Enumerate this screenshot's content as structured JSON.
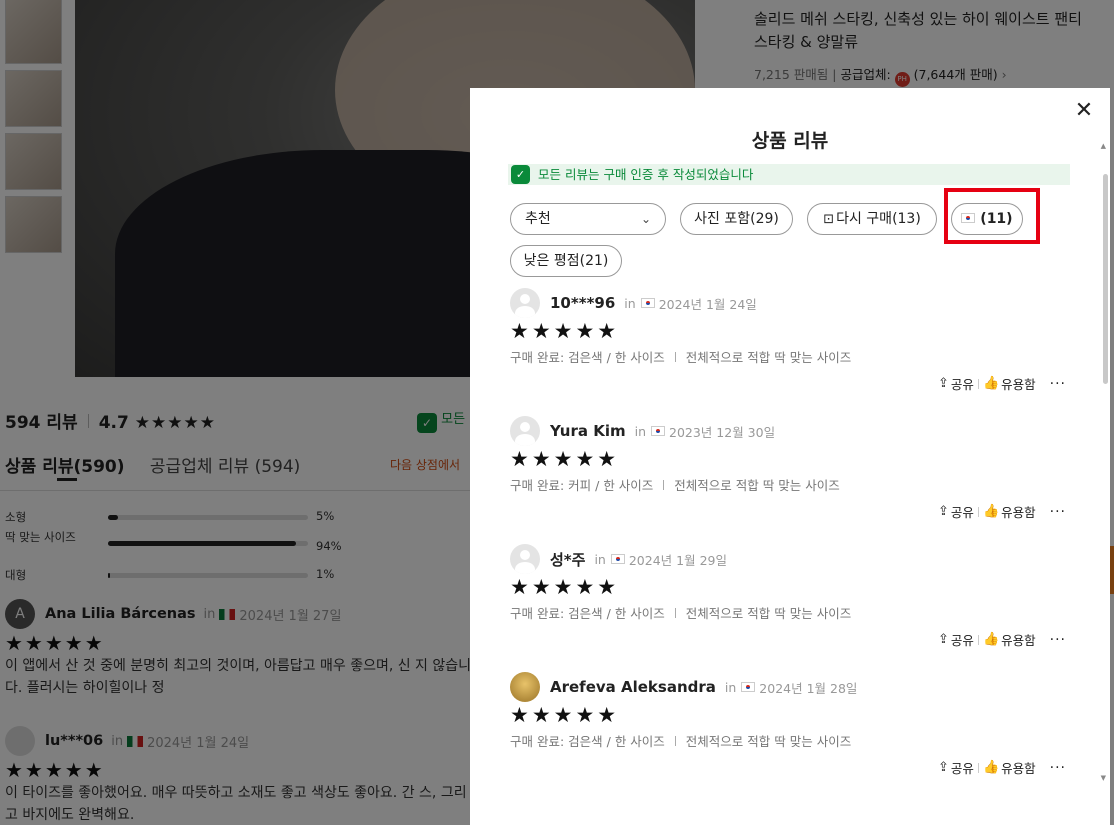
{
  "background": {
    "product_title": "솔리드 메쉬 스타킹, 신축성 있는 하이 웨이스트 팬티 스타킹 & 양말류",
    "sold": "7,215 판매됨",
    "supplier_label": "공급업체:",
    "supplier_sales": "(7,644개 판매)",
    "review_count": "594 리뷰",
    "rating": "4.7",
    "rating_stars": "★★★★★",
    "verified_short": "모든",
    "tab_product": "상품 리뷰(590)",
    "tab_supplier": "공급업체 리뷰 (594)",
    "next_store": "다음 상점에서",
    "fit": [
      {
        "label": "소형",
        "pct": "5%",
        "value": 0.05
      },
      {
        "label": "딱 맞는 사이즈",
        "pct": "94%",
        "value": 0.94
      },
      {
        "label": "대형",
        "pct": "1%",
        "value": 0.01
      }
    ],
    "reviews": [
      {
        "avatar": "A",
        "name": "Ana Lilia Bárcenas",
        "in": "in",
        "date": "2024년 1월 27일",
        "stars": "★★★★★",
        "text": "이 앱에서 산 것 중에 분명히 최고의 것이며, 아름답고 매우 좋으며, 신 지 않습니다. 플러시는 하이힐이나 정"
      },
      {
        "avatar": "",
        "name": "lu***06",
        "in": "in",
        "date": "2024년 1월 24일",
        "stars": "★★★★★",
        "text": "이 타이즈를 좋아했어요. 매우 따뜻하고 소재도 좋고 색상도 좋아요. 간 스, 그리고 바지에도 완벽해요."
      }
    ]
  },
  "modal": {
    "title": "상품 리뷰",
    "notice": "모든 리뷰는 구매 인증 후 작성되었습니다",
    "filters": {
      "sort": "추천",
      "photo": "사진 포함(29)",
      "repurchase": "다시 구매(13)",
      "country": "(11)",
      "low_rating": "낮은 평점(21)"
    },
    "reviews": [
      {
        "name": "10***96",
        "in": "in",
        "date": "2024년 1월 24일",
        "stars": "★★★★★",
        "purchase": "구매 완료: 검은색 / 한 사이즈",
        "fit": "전체적으로 적합 딱 맞는 사이즈",
        "share": "공유",
        "helpful": "유용함",
        "more": "···"
      },
      {
        "name": "Yura Kim",
        "in": "in",
        "date": "2023년 12월 30일",
        "stars": "★★★★★",
        "purchase": "구매 완료: 커피 / 한 사이즈",
        "fit": "전체적으로 적합 딱 맞는 사이즈",
        "share": "공유",
        "helpful": "유용함",
        "more": "···"
      },
      {
        "name": "성*주",
        "in": "in",
        "date": "2024년 1월 29일",
        "stars": "★★★★★",
        "purchase": "구매 완료: 검은색 / 한 사이즈",
        "fit": "전체적으로 적합 딱 맞는 사이즈",
        "share": "공유",
        "helpful": "유용함",
        "more": "···"
      },
      {
        "name": "Arefeva Aleksandra",
        "in": "in",
        "date": "2024년 1월 28일",
        "stars": "★★★★★",
        "purchase": "구매 완료: 검은색 / 한 사이즈",
        "fit": "전체적으로 적합 딱 맞는 사이즈",
        "share": "공유",
        "helpful": "유용함",
        "more": "···"
      }
    ]
  },
  "colors": {
    "highlight": "#e60012",
    "verified": "#0a8a3a",
    "overlay": "rgba(0,0,0,0.5)"
  }
}
